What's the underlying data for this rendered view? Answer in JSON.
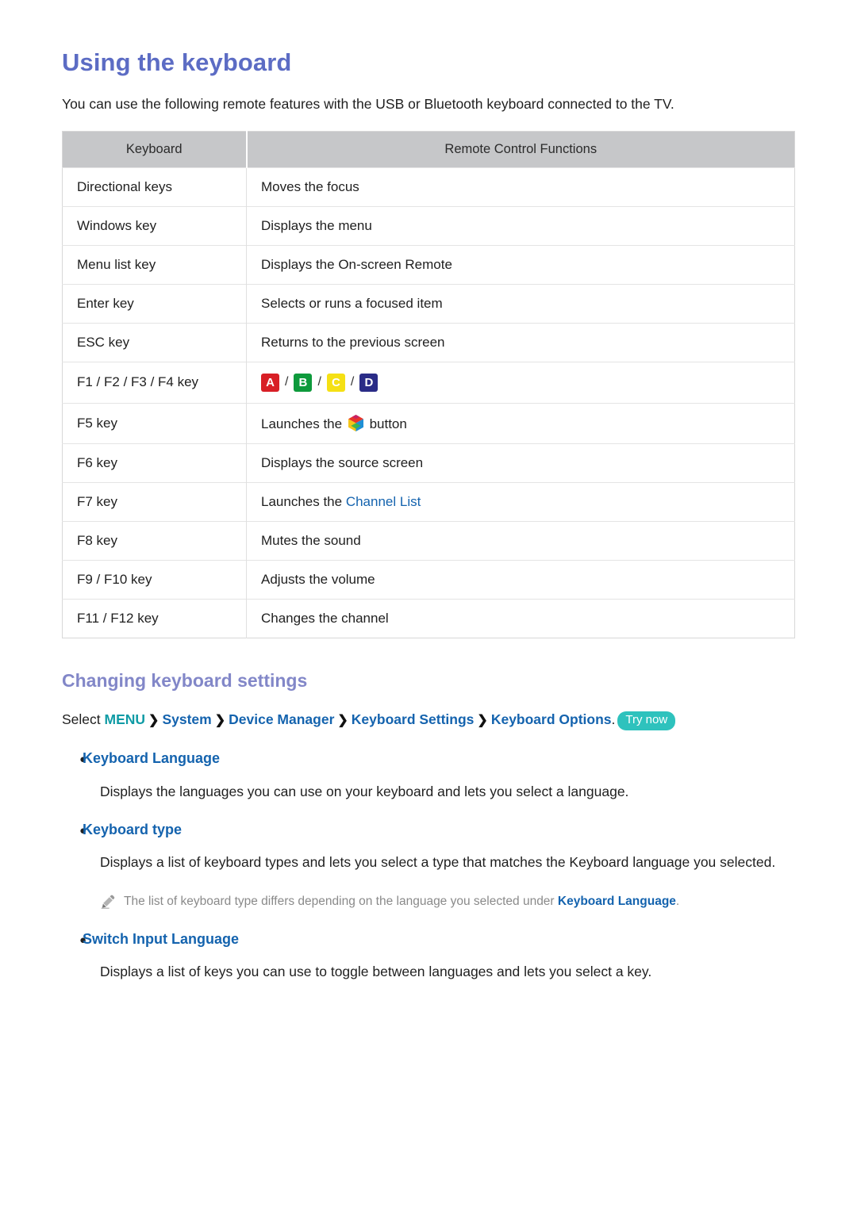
{
  "page": {
    "title": "Using the keyboard",
    "intro": "You can use the following remote features with the USB or Bluetooth keyboard connected to the TV."
  },
  "table": {
    "headers": {
      "keyboard": "Keyboard",
      "functions": "Remote Control Functions"
    },
    "rows": [
      {
        "key": "Directional keys",
        "fn": "Moves the focus"
      },
      {
        "key": "Windows key",
        "fn": "Displays the menu"
      },
      {
        "key": "Menu list key",
        "fn": "Displays the On-screen Remote"
      },
      {
        "key": "Enter key",
        "fn": "Selects or runs a focused item"
      },
      {
        "key": "ESC key",
        "fn": "Returns to the previous screen"
      },
      {
        "key": "F1 / F2 / F3 / F4 key",
        "fn": "",
        "type": "color-chips"
      },
      {
        "key": "F5 key",
        "fn": "",
        "type": "hub-button"
      },
      {
        "key": "F6 key",
        "fn": "Displays the source screen"
      },
      {
        "key": "F7 key",
        "fn": "",
        "type": "channel-list"
      },
      {
        "key": "F8 key",
        "fn": "Mutes the sound"
      },
      {
        "key": "F9 / F10 key",
        "fn": "Adjusts the volume"
      },
      {
        "key": "F11 / F12 key",
        "fn": "Changes the channel"
      }
    ],
    "chips": [
      {
        "letter": "A",
        "color": "#d81f26"
      },
      {
        "letter": "B",
        "color": "#0e9a3c"
      },
      {
        "letter": "C",
        "color": "#f5e014"
      },
      {
        "letter": "D",
        "color": "#2a2c87"
      }
    ],
    "chip_separator": "/",
    "f5_prefix": "Launches the",
    "f5_suffix": "button",
    "f7_prefix": "Launches the",
    "f7_link": "Channel List"
  },
  "settings": {
    "section_title": "Changing keyboard settings",
    "path": {
      "select_word": "Select",
      "menu": "MENU",
      "chevron": "❯",
      "steps": [
        "System",
        "Device Manager",
        "Keyboard Settings",
        "Keyboard Options"
      ],
      "period": ".",
      "try_now": "Try now"
    },
    "bullet_marker": "●",
    "items": [
      {
        "label": "Keyboard Language",
        "body": "Displays the languages you can use on your keyboard and lets you select a language."
      },
      {
        "label": "Keyboard type",
        "body": "Displays a list of keyboard types and lets you select a type that matches the Keyboard language you selected."
      },
      {
        "label": "Switch Input Language",
        "body": "Displays a list of keys you can use to toggle between languages and lets you select a key."
      }
    ],
    "note": {
      "icon": "pencil-icon",
      "text_before": "The list of keyboard type differs depending on the language you selected under",
      "link": "Keyboard Language",
      "text_after": "."
    }
  },
  "colors": {
    "title": "#5c6cc4",
    "section_title": "#8287c8",
    "link": "#1463ae",
    "menu": "#0f9ba5",
    "badge": "#2ec2bd",
    "table_header_bg": "#c6c7c9"
  }
}
